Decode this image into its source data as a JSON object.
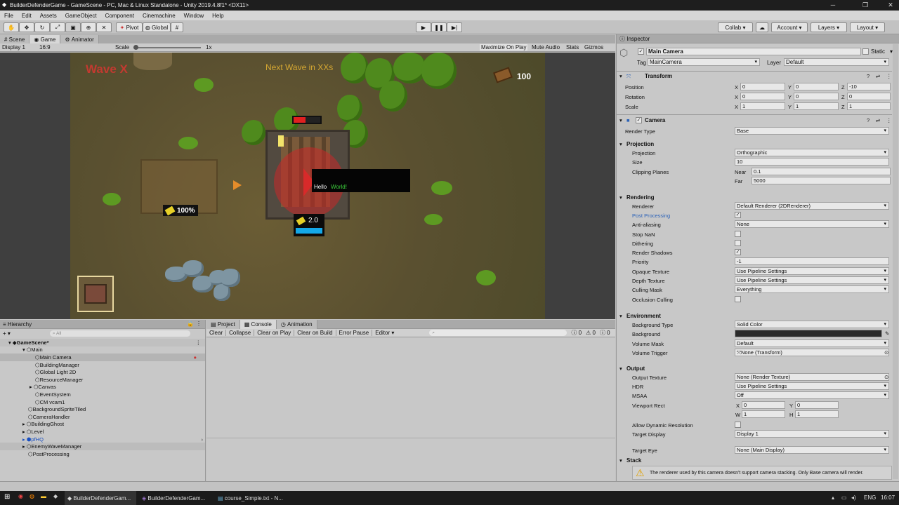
{
  "window": {
    "title": "BuilderDefenderGame - GameScene - PC, Mac & Linux Standalone - Unity 2019.4.8f1* <DX11>"
  },
  "menu": [
    "File",
    "Edit",
    "Assets",
    "GameObject",
    "Component",
    "Cinemachine",
    "Window",
    "Help"
  ],
  "toolbar": {
    "pivot": "Pivot",
    "global": "Global",
    "collab": "Collab",
    "account": "Account",
    "layers": "Layers",
    "layout": "Layout"
  },
  "tabs": {
    "scene": "Scene",
    "game": "Game",
    "animator": "Animator"
  },
  "gamebar": {
    "display": "Display 1",
    "aspect": "16:9",
    "scale_label": "Scale",
    "scale_value": "1x",
    "maximize": "Maximize On Play",
    "mute": "Mute Audio",
    "stats": "Stats",
    "gizmos": "Gizmos"
  },
  "game": {
    "wave": "Wave X",
    "next_wave": "Next Wave in XXs",
    "wood_count": "100",
    "building_pct": "100%",
    "hq_value": "2.0",
    "hello": "Hello",
    "world": "World!"
  },
  "hierarchy": {
    "title": "Hierarchy",
    "search_placeholder": "All",
    "items": [
      {
        "label": "GameScene*"
      },
      {
        "label": "Main"
      },
      {
        "label": "Main Camera"
      },
      {
        "label": "BuildingManager"
      },
      {
        "label": "Global Light 2D"
      },
      {
        "label": "ResourceManager"
      },
      {
        "label": "Canvas"
      },
      {
        "label": "EventSystem"
      },
      {
        "label": "CM vcam1"
      },
      {
        "label": "BackgroundSpriteTiled"
      },
      {
        "label": "CameraHandler"
      },
      {
        "label": "BuildingGhost"
      },
      {
        "label": "Level"
      },
      {
        "label": "pfHQ"
      },
      {
        "label": "EnemyWaveManager"
      },
      {
        "label": "PostProcessing"
      }
    ]
  },
  "console": {
    "tabs": [
      "Project",
      "Console",
      "Animation"
    ],
    "buttons": [
      "Clear",
      "Collapse",
      "Clear on Play",
      "Clear on Build",
      "Error Pause",
      "Editor"
    ],
    "counts": [
      "0",
      "0",
      "0"
    ]
  },
  "inspector": {
    "title": "Inspector",
    "object_name": "Main Camera",
    "static": "Static",
    "tag_label": "Tag",
    "tag": "MainCamera",
    "layer_label": "Layer",
    "layer": "Default",
    "transform": {
      "title": "Transform",
      "position": {
        "label": "Position",
        "x": "0",
        "y": "0",
        "z": "-10"
      },
      "rotation": {
        "label": "Rotation",
        "x": "0",
        "y": "0",
        "z": "0"
      },
      "scale": {
        "label": "Scale",
        "x": "1",
        "y": "1",
        "z": "1"
      }
    },
    "camera_title": "Camera",
    "render_type": {
      "label": "Render Type",
      "value": "Base"
    },
    "projection_section": "Projection",
    "projection": {
      "label": "Projection",
      "value": "Orthographic"
    },
    "size": {
      "label": "Size",
      "value": "10"
    },
    "clipping": {
      "label": "Clipping Planes",
      "near_label": "Near",
      "near": "0.1",
      "far_label": "Far",
      "far": "5000"
    },
    "rendering_section": "Rendering",
    "renderer": {
      "label": "Renderer",
      "value": "Default Renderer (2DRenderer)"
    },
    "post_processing": "Post Processing",
    "anti_aliasing": {
      "label": "Anti-aliasing",
      "value": "None"
    },
    "stop_nan": "Stop NaN",
    "dithering": "Dithering",
    "render_shadows": "Render Shadows",
    "priority": {
      "label": "Priority",
      "value": "-1"
    },
    "opaque": {
      "label": "Opaque Texture",
      "value": "Use Pipeline Settings"
    },
    "depth": {
      "label": "Depth Texture",
      "value": "Use Pipeline Settings"
    },
    "culling": {
      "label": "Culling Mask",
      "value": "Everything"
    },
    "occlusion": "Occlusion Culling",
    "environment_section": "Environment",
    "bg_type": {
      "label": "Background Type",
      "value": "Solid Color"
    },
    "background": "Background",
    "volume_mask": {
      "label": "Volume Mask",
      "value": "Default"
    },
    "volume_trigger": {
      "label": "Volume Trigger",
      "value": "None (Transform)"
    },
    "output_section": "Output",
    "output_texture": {
      "label": "Output Texture",
      "value": "None (Render Texture)"
    },
    "hdr": {
      "label": "HDR",
      "value": "Use Pipeline Settings"
    },
    "msaa": {
      "label": "MSAA",
      "value": "Off"
    },
    "viewport": {
      "label": "Viewport Rect",
      "x": "0",
      "y": "0",
      "w": "1",
      "h": "1"
    },
    "dyn_res": "Allow Dynamic Resolution",
    "target_display": {
      "label": "Target Display",
      "value": "Display 1"
    },
    "target_eye": {
      "label": "Target Eye",
      "value": "None (Main Display)"
    },
    "stack_section": "Stack",
    "warning": "The renderer used by this camera doesn't support camera stacking. Only Base camera will render."
  },
  "taskbar": {
    "apps": [
      "BuilderDefenderGam...",
      "BuilderDefenderGam...",
      "course_Simple.txt - N..."
    ],
    "lang": "ENG",
    "time": "16:07"
  }
}
